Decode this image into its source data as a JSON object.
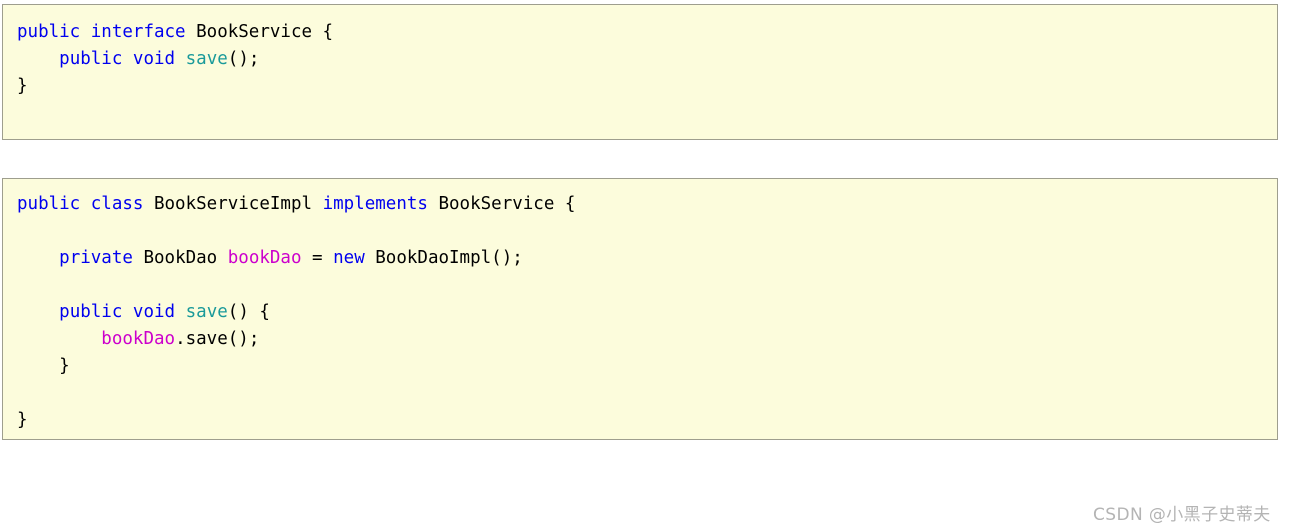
{
  "page": {
    "background_color": "#ffffff",
    "watermark": "CSDN @小黑子史蒂夫",
    "watermark_color": "#b4b4b4"
  },
  "theme": {
    "code_background": "#fcfcdc",
    "code_border": "#9e9e8e",
    "keyword_color": "#0000ef",
    "method_color": "#1a9a9a",
    "field_color": "#cc00cc",
    "plain_color": "#000000"
  },
  "blocks": [
    {
      "id": "interface-bookservice",
      "title": "BookService interface",
      "lines": [
        {
          "id": "line-1",
          "text": "public interface BookService {",
          "tokens": [
            {
              "t": "public",
              "c": "kw"
            },
            {
              "t": " ",
              "c": "plain"
            },
            {
              "t": "interface",
              "c": "kw"
            },
            {
              "t": " BookService {",
              "c": "plain"
            }
          ]
        },
        {
          "id": "line-2",
          "text": "    public void save();",
          "tokens": [
            {
              "t": "    ",
              "c": "plain"
            },
            {
              "t": "public",
              "c": "kw"
            },
            {
              "t": " ",
              "c": "plain"
            },
            {
              "t": "void",
              "c": "kw"
            },
            {
              "t": " ",
              "c": "plain"
            },
            {
              "t": "save",
              "c": "meth"
            },
            {
              "t": "();",
              "c": "plain"
            }
          ]
        },
        {
          "id": "line-3",
          "text": "}",
          "tokens": [
            {
              "t": "}",
              "c": "plain"
            }
          ]
        }
      ]
    },
    {
      "id": "class-bookserviceimpl",
      "title": "BookServiceImpl class",
      "lines": [
        {
          "id": "line-1",
          "text": "public class BookServiceImpl implements BookService {",
          "tokens": [
            {
              "t": "public",
              "c": "kw"
            },
            {
              "t": " ",
              "c": "plain"
            },
            {
              "t": "class",
              "c": "kw"
            },
            {
              "t": " BookServiceImpl ",
              "c": "plain"
            },
            {
              "t": "implements",
              "c": "kw"
            },
            {
              "t": " BookService {",
              "c": "plain"
            }
          ]
        },
        {
          "id": "line-2",
          "text": "",
          "tokens": []
        },
        {
          "id": "line-3",
          "text": "    private BookDao bookDao = new BookDaoImpl();",
          "tokens": [
            {
              "t": "    ",
              "c": "plain"
            },
            {
              "t": "private",
              "c": "kw"
            },
            {
              "t": " BookDao ",
              "c": "plain"
            },
            {
              "t": "bookDao",
              "c": "fld"
            },
            {
              "t": " = ",
              "c": "plain"
            },
            {
              "t": "new",
              "c": "kw"
            },
            {
              "t": " BookDaoImpl();",
              "c": "plain"
            }
          ]
        },
        {
          "id": "line-4",
          "text": "",
          "tokens": []
        },
        {
          "id": "line-5",
          "text": "    public void save() {",
          "tokens": [
            {
              "t": "    ",
              "c": "plain"
            },
            {
              "t": "public",
              "c": "kw"
            },
            {
              "t": " ",
              "c": "plain"
            },
            {
              "t": "void",
              "c": "kw"
            },
            {
              "t": " ",
              "c": "plain"
            },
            {
              "t": "save",
              "c": "meth"
            },
            {
              "t": "() {",
              "c": "plain"
            }
          ]
        },
        {
          "id": "line-6",
          "text": "        bookDao.save();",
          "tokens": [
            {
              "t": "        ",
              "c": "plain"
            },
            {
              "t": "bookDao",
              "c": "fld"
            },
            {
              "t": ".save();",
              "c": "plain"
            }
          ]
        },
        {
          "id": "line-7",
          "text": "    }",
          "tokens": [
            {
              "t": "    }",
              "c": "plain"
            }
          ]
        },
        {
          "id": "line-8",
          "text": "",
          "tokens": []
        },
        {
          "id": "line-9",
          "text": "}",
          "tokens": [
            {
              "t": "}",
              "c": "plain"
            }
          ]
        }
      ]
    }
  ]
}
